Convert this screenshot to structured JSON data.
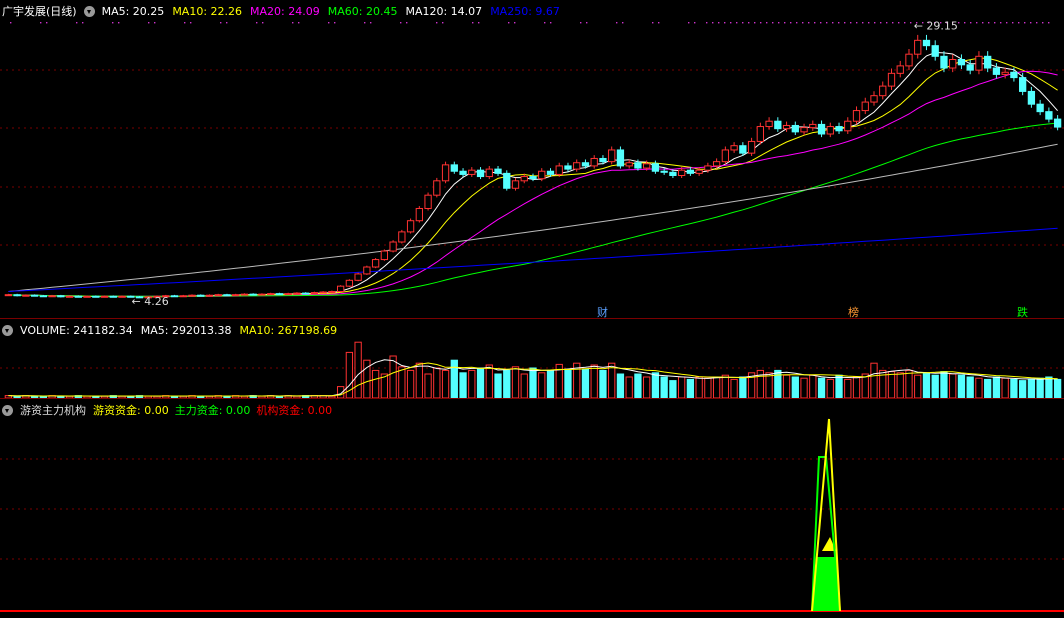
{
  "stock": {
    "name": "广宇发展(日线)"
  },
  "price_header": [
    {
      "label": "MA5: 20.25",
      "color": "#ffffff"
    },
    {
      "label": "MA10: 22.26",
      "color": "#ffff00"
    },
    {
      "label": "MA20: 24.09",
      "color": "#ff00ff"
    },
    {
      "label": "MA60: 20.45",
      "color": "#00ff00"
    },
    {
      "label": "MA120: 14.07",
      "color": "#ffffff"
    },
    {
      "label": "MA250: 9.67",
      "color": "#0000ff"
    }
  ],
  "volume_header": [
    {
      "label": "VOLUME: 241182.34",
      "color": "#ffffff"
    },
    {
      "label": "MA5: 292013.38",
      "color": "#ffffff"
    },
    {
      "label": "MA10: 267198.69",
      "color": "#ffff00"
    }
  ],
  "indicator_header": {
    "name": "游资主力机构",
    "items": [
      {
        "label": "游资资金: 0.00",
        "color": "#ffff00"
      },
      {
        "label": "主力资金: 0.00",
        "color": "#00ff00"
      },
      {
        "label": "机构资金: 0.00",
        "color": "#ff0000"
      }
    ]
  },
  "colors": {
    "up": "#ff3232",
    "down": "#54ffff",
    "grid": "#7a0000"
  },
  "chart_data": [
    {
      "type": "candlestick",
      "annotations": {
        "high": "29.15",
        "low": "4.26"
      },
      "events": [
        {
          "label": "财",
          "color": "#5aa0ff"
        },
        {
          "label": "榜",
          "color": "#ff9933"
        },
        {
          "label": "跌",
          "color": "#00ff00"
        }
      ],
      "ylim": [
        4.0,
        30.5
      ],
      "series_closes": [
        4.5,
        4.4,
        4.45,
        4.4,
        4.35,
        4.4,
        4.3,
        4.35,
        4.3,
        4.35,
        4.3,
        4.35,
        4.3,
        4.35,
        4.3,
        4.26,
        4.3,
        4.35,
        4.4,
        4.35,
        4.4,
        4.45,
        4.4,
        4.45,
        4.5,
        4.45,
        4.5,
        4.55,
        4.5,
        4.55,
        4.6,
        4.55,
        4.6,
        4.65,
        4.6,
        4.7,
        4.75,
        4.8,
        5.3,
        5.85,
        6.45,
        7.1,
        7.8,
        8.6,
        9.45,
        10.4,
        11.45,
        12.6,
        13.85,
        15.2,
        16.7,
        16.1,
        15.8,
        16.2,
        15.6,
        16.3,
        15.9,
        14.5,
        15.2,
        15.6,
        15.4,
        16.1,
        15.8,
        16.6,
        16.3,
        16.9,
        16.6,
        17.3,
        17.0,
        18.1,
        16.6,
        16.9,
        16.4,
        16.8,
        16.1,
        16.0,
        15.7,
        16.2,
        15.9,
        16.2,
        16.6,
        17.0,
        18.1,
        18.5,
        17.8,
        18.9,
        20.3,
        20.8,
        20.1,
        20.4,
        19.8,
        20.2,
        20.5,
        19.6,
        20.3,
        19.9,
        20.8,
        21.8,
        22.6,
        23.2,
        24.1,
        25.3,
        26.0,
        27.1,
        28.4,
        27.9,
        26.9,
        25.8,
        26.6,
        26.1,
        25.6,
        26.9,
        25.8,
        25.2,
        25.4,
        24.9,
        23.6,
        22.4,
        21.7,
        21.0,
        20.25
      ]
    },
    {
      "type": "bar",
      "name": "VOLUME",
      "values": [
        0.04,
        0.03,
        0.04,
        0.03,
        0.03,
        0.04,
        0.03,
        0.03,
        0.04,
        0.03,
        0.03,
        0.03,
        0.04,
        0.03,
        0.03,
        0.04,
        0.03,
        0.03,
        0.04,
        0.03,
        0.03,
        0.04,
        0.03,
        0.03,
        0.04,
        0.03,
        0.04,
        0.03,
        0.04,
        0.03,
        0.04,
        0.03,
        0.04,
        0.03,
        0.04,
        0.04,
        0.04,
        0.03,
        0.19,
        0.76,
        0.93,
        0.63,
        0.46,
        0.4,
        0.7,
        0.52,
        0.46,
        0.58,
        0.4,
        0.5,
        0.46,
        0.63,
        0.42,
        0.46,
        0.5,
        0.55,
        0.4,
        0.46,
        0.52,
        0.4,
        0.5,
        0.42,
        0.46,
        0.56,
        0.48,
        0.58,
        0.48,
        0.55,
        0.46,
        0.58,
        0.4,
        0.35,
        0.4,
        0.35,
        0.42,
        0.35,
        0.29,
        0.35,
        0.31,
        0.35,
        0.33,
        0.35,
        0.38,
        0.31,
        0.35,
        0.42,
        0.46,
        0.42,
        0.46,
        0.38,
        0.35,
        0.33,
        0.38,
        0.33,
        0.31,
        0.38,
        0.31,
        0.35,
        0.4,
        0.58,
        0.46,
        0.44,
        0.42,
        0.46,
        0.38,
        0.42,
        0.38,
        0.44,
        0.4,
        0.38,
        0.35,
        0.33,
        0.31,
        0.35,
        0.33,
        0.31,
        0.29,
        0.31,
        0.33,
        0.35,
        0.31
      ]
    },
    {
      "type": "area",
      "name": "游资主力机构",
      "series": [
        {
          "name": "游资资金",
          "values": [
            0.0,
            0.0,
            0.36,
            0.0,
            0.0
          ]
        },
        {
          "name": "主力资金",
          "values": [
            0.0,
            0.0,
            0.31,
            0.0,
            0.0
          ]
        }
      ],
      "ylim": [
        0,
        1
      ]
    }
  ]
}
